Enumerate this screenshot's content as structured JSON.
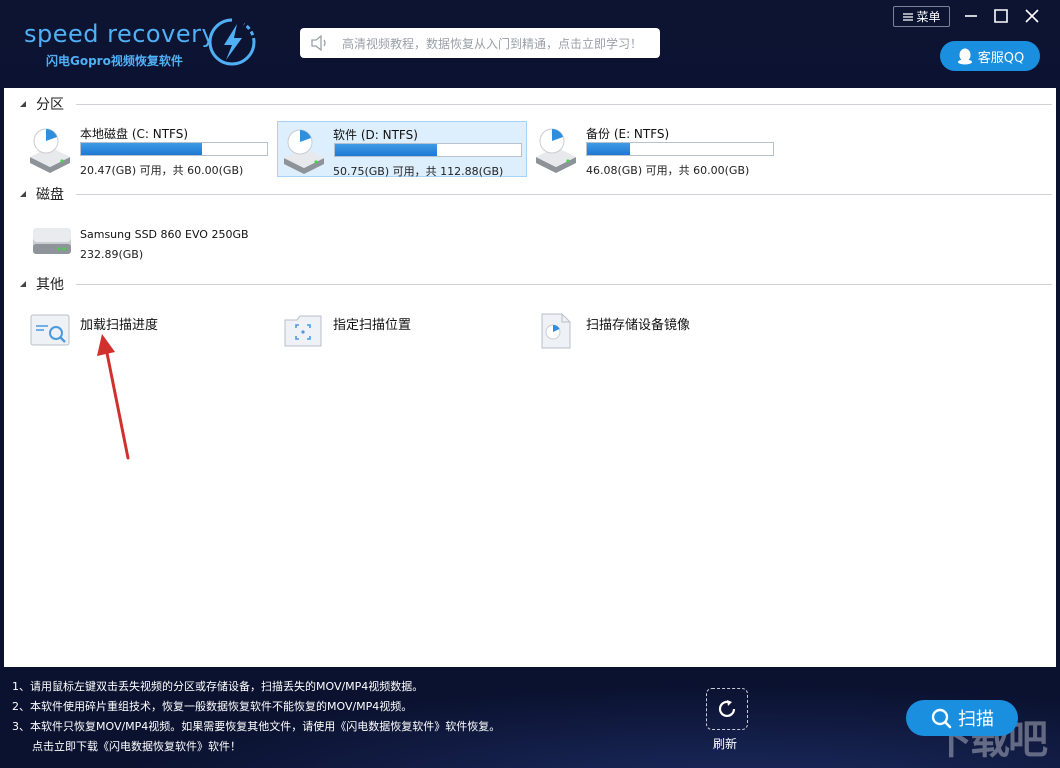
{
  "header": {
    "logo_title": "speed recovery",
    "logo_subtitle": "闪电Gopro视频恢复软件",
    "notice_text": "高清视频教程，数据恢复从入门到精通，点击立即学习！",
    "menu_label": "菜单",
    "qq_label": "客服QQ"
  },
  "sections": {
    "partitions": "分区",
    "disks": "磁盘",
    "others": "其他"
  },
  "partitions": [
    {
      "name": "本地磁盘 (C: NTFS)",
      "info": "20.47(GB) 可用，共 60.00(GB)",
      "used_fraction": 0.65,
      "selected": false
    },
    {
      "name": "软件 (D: NTFS)",
      "info": "50.75(GB) 可用，共 112.88(GB)",
      "used_fraction": 0.55,
      "selected": true
    },
    {
      "name": "备份 (E: NTFS)",
      "info": "46.08(GB) 可用，共 60.00(GB)",
      "used_fraction": 0.23,
      "selected": false
    }
  ],
  "disks": [
    {
      "name": "Samsung SSD 860 EVO 250GB",
      "size": "232.89(GB)"
    }
  ],
  "others": [
    {
      "label": "加载扫描进度",
      "icon": "load-scan-progress-icon"
    },
    {
      "label": "指定扫描位置",
      "icon": "specify-scan-location-icon"
    },
    {
      "label": "扫描存储设备镜像",
      "icon": "scan-device-image-icon"
    }
  ],
  "footer": {
    "tips": [
      "1、请用鼠标左键双击丢失视频的分区或存储设备，扫描丢失的MOV/MP4视频数据。",
      "2、本软件使用碎片重组技术，恢复一般数据恢复软件不能恢复的MOV/MP4视频。",
      "3、本软件只恢复MOV/MP4视频。如果需要恢复其他文件，请使用《闪电数据恢复软件》软件恢复。",
      "点击立即下载《闪电数据恢复软件》软件！"
    ],
    "refresh_label": "刷新",
    "scan_label": "扫描",
    "watermark": "下载吧"
  },
  "colors": {
    "accent": "#1a8fe0",
    "header_bg": "#0d1431",
    "logo": "#4fb0f6",
    "selected_bg": "#ddeefc"
  }
}
